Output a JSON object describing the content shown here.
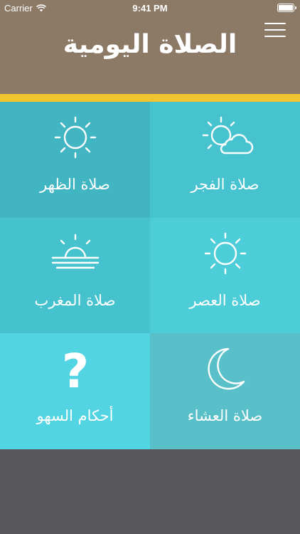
{
  "status_bar": {
    "carrier": "Carrier",
    "time": "9:41 PM"
  },
  "header": {
    "title": "الصلاة اليومية"
  },
  "tiles": {
    "fajr": "صلاة الفجر",
    "dhuhr": "صلاة الظهر",
    "asr": "صلاة العصر",
    "maghrib": "صلاة المغرب",
    "isha": "صلاة العشاء",
    "sahw": "أحكام السهو"
  },
  "colors": {
    "header": "#8c7a67",
    "accent": "#f2c530",
    "background": "#58585a",
    "tiles": [
      "#47c3d0",
      "#41b5c2",
      "#4ccdd7",
      "#45c2ce",
      "#59c0c9",
      "#52d4e2"
    ]
  },
  "icons": {
    "fajr": "sun-cloud-icon",
    "dhuhr": "sun-icon",
    "asr": "sun-icon",
    "maghrib": "sunset-icon",
    "isha": "crescent-moon-icon",
    "sahw": "question-mark-icon"
  }
}
